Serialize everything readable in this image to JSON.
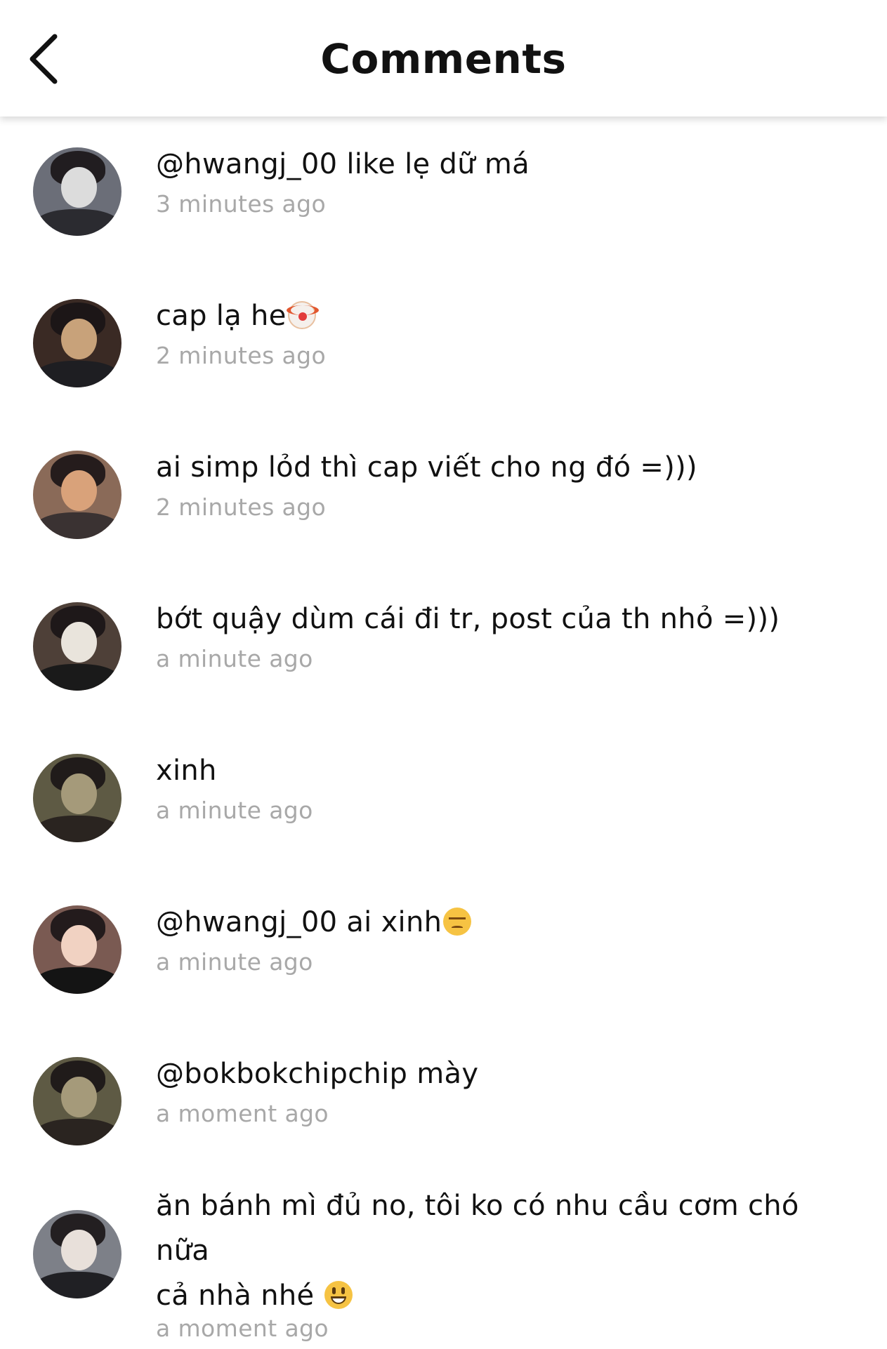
{
  "header": {
    "title": "Comments",
    "back_icon": "chevron-left-icon"
  },
  "comments": [
    {
      "text": "@hwangj_00 like lẹ dữ má",
      "emoji": "",
      "time": "3 minutes ago",
      "avatar_colors": [
        "#6b6e78",
        "#dcdcdc",
        "#2b2b30"
      ]
    },
    {
      "text": "cap lạ he",
      "emoji": "clown",
      "time": "2 minutes ago",
      "avatar_colors": [
        "#3a2a24",
        "#c8a27a",
        "#1e1e22"
      ]
    },
    {
      "text": "ai simp lỏd thì cap viết cho ng đó =)))",
      "emoji": "",
      "time": "2 minutes ago",
      "avatar_colors": [
        "#8a6a58",
        "#d9a27a",
        "#3a3232"
      ]
    },
    {
      "text": "bớt quậy dùm cái đi tr, post của th nhỏ =)))",
      "emoji": "",
      "time": "a minute ago",
      "avatar_colors": [
        "#4e4038",
        "#e9e4dc",
        "#1a1a1a"
      ]
    },
    {
      "text": "xinh",
      "emoji": "",
      "time": "a minute ago",
      "avatar_colors": [
        "#5e5a44",
        "#a59a7a",
        "#2a2420"
      ]
    },
    {
      "text": "@hwangj_00 ai xinh",
      "emoji": "unamused",
      "time": "a minute ago",
      "avatar_colors": [
        "#7a5a52",
        "#f1d2c2",
        "#141414"
      ]
    },
    {
      "text": "@bokbokchipchip mày",
      "emoji": "",
      "time": "a moment ago",
      "avatar_colors": [
        "#5e5a44",
        "#a59a7a",
        "#2a2420"
      ]
    },
    {
      "text": "ăn bánh mì đủ no, tôi ko có nhu cầu cơm chó nữa\ncả nhà nhé ",
      "emoji": "smiley",
      "time": "a moment ago",
      "avatar_colors": [
        "#7d8088",
        "#e8e0da",
        "#202024"
      ]
    }
  ]
}
